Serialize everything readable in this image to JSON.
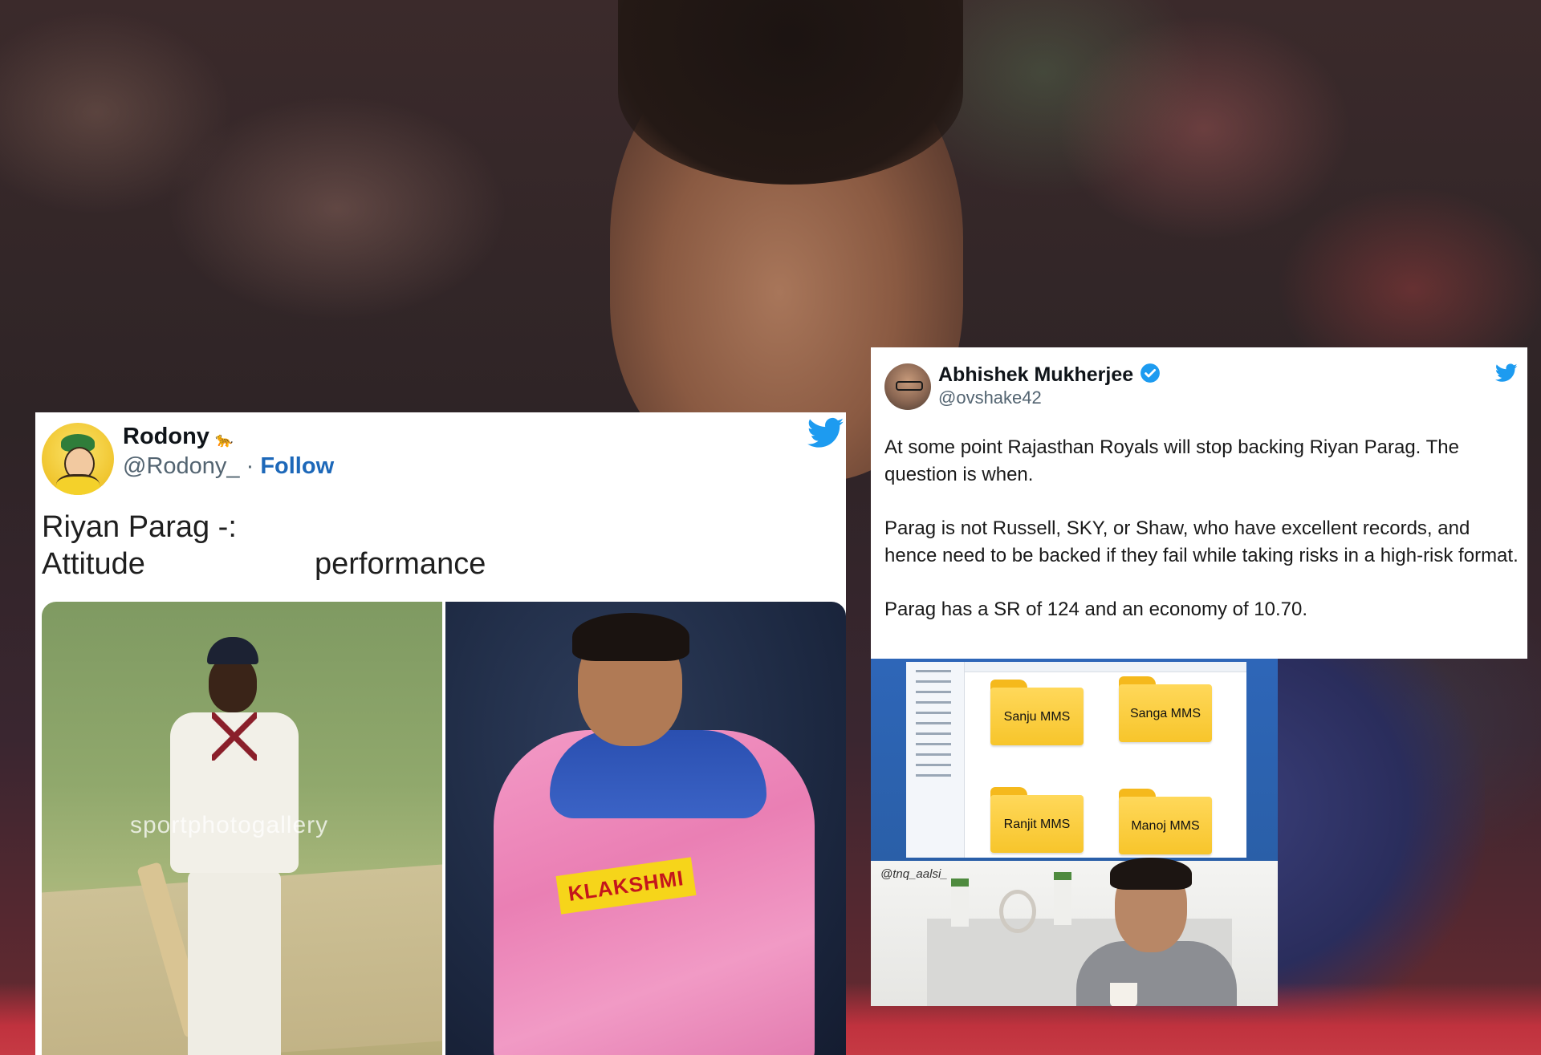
{
  "tweet_left": {
    "display_name": "Rodony",
    "handle": "@Rodony_",
    "separator": " · ",
    "follow_label": "Follow",
    "text_line1": "Riyan Parag -:",
    "text_line2": "Attitude                    performance",
    "image_watermark": "sportphotogallery",
    "image_sponsor": "KLAKSHMI"
  },
  "tweet_right": {
    "display_name": "Abhishek Mukherjee",
    "handle": "@ovshake42",
    "paragraphs": [
      "At some point Rajasthan Royals will stop backing Riyan Parag. The question is when.",
      "Parag is not Russell, SKY, or Shaw, who have excellent records, and hence need to be backed if they fail while taking risks in a high-risk format.",
      "Parag has a SR of 124 and an economy of 10.70."
    ]
  },
  "meme": {
    "folders": [
      "Sanju MMS",
      "Sanga MMS",
      "Ranjit MMS",
      "Manoj MMS"
    ],
    "credit": "@tnq_aalsi_"
  },
  "colors": {
    "twitter_blue": "#1d9bf0",
    "follow_blue": "#1d68b9",
    "folder_yellow": "#f7c52b"
  },
  "icons": [
    "twitter-bird-icon",
    "verified-badge-icon",
    "folder-icon"
  ]
}
